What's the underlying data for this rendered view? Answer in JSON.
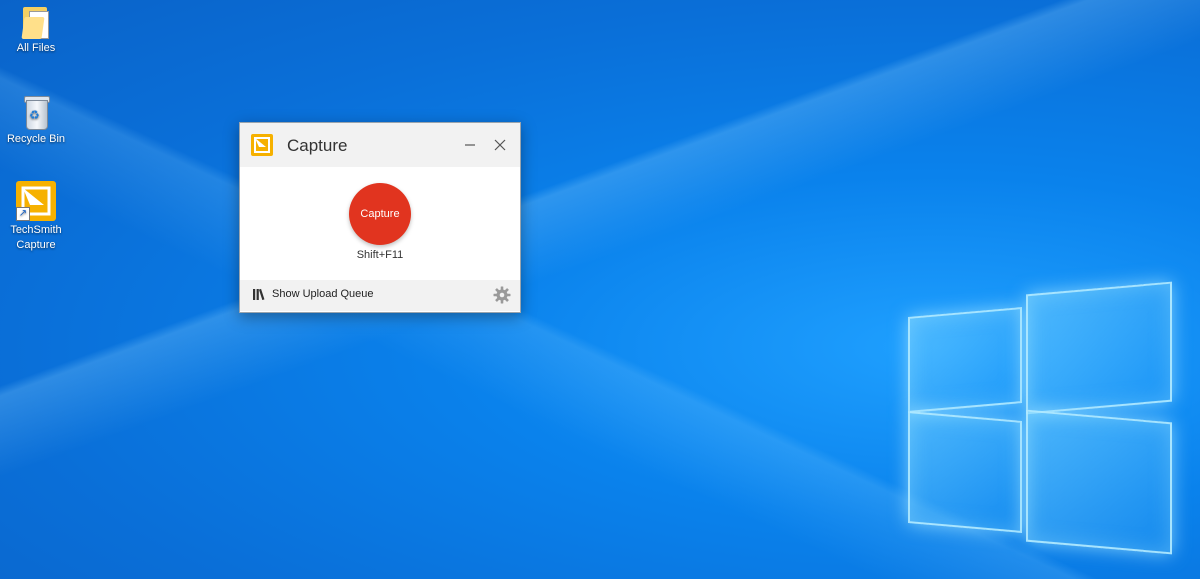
{
  "desktop": {
    "icons": [
      {
        "label": "All Files",
        "icon": "folder-icon"
      },
      {
        "label": "Recycle Bin",
        "icon": "recycle-bin-icon"
      },
      {
        "label_line1": "TechSmith",
        "label_line2": "Capture",
        "icon": "techsmith-capture-icon"
      }
    ]
  },
  "capture_window": {
    "title": "Capture",
    "capture_button_label": "Capture",
    "hotkey": "Shift+F11",
    "upload_queue_label": "Show Upload Queue",
    "accent_color": "#e1341f",
    "logo_color": "#f6b100",
    "icons": {
      "minimize": "minimize-icon",
      "close": "close-icon",
      "settings": "gear-icon",
      "queue": "library-icon"
    }
  }
}
